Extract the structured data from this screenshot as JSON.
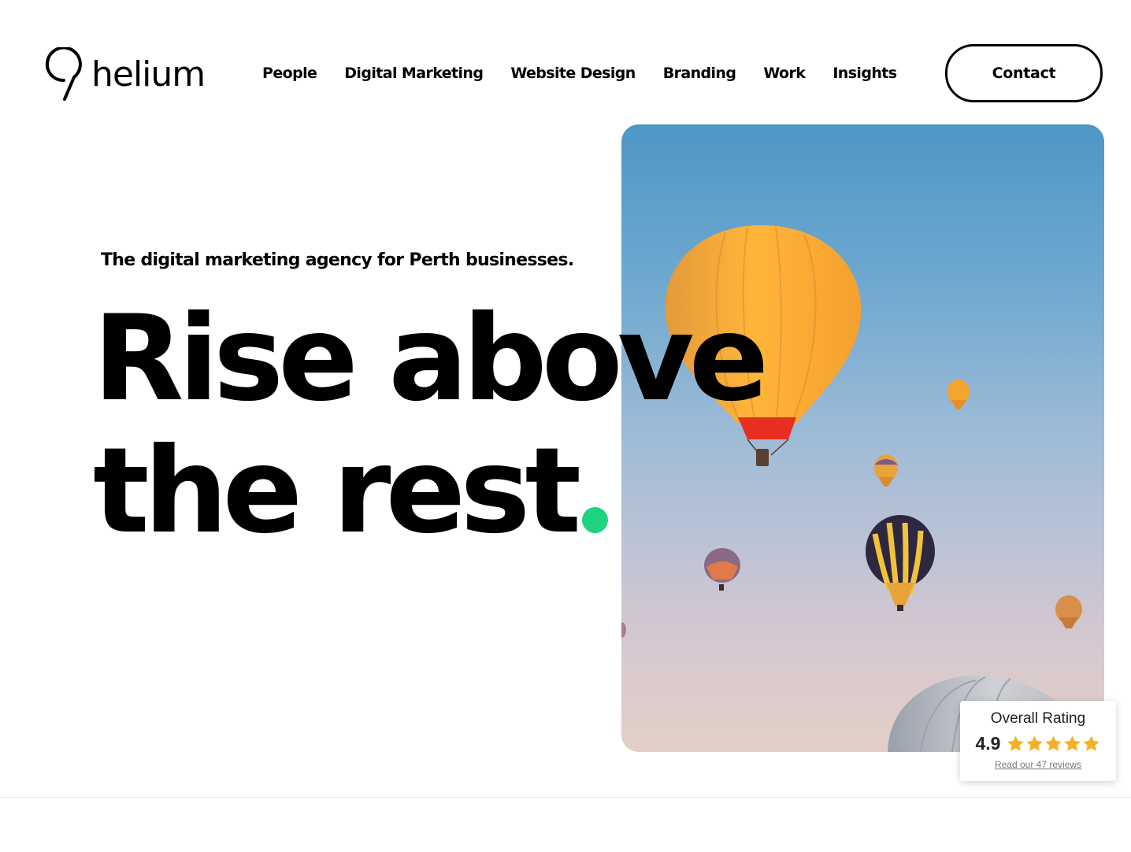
{
  "brand": {
    "logo_text": "helium",
    "logo_icon": "map-pin-icon"
  },
  "nav": {
    "items": [
      {
        "label": "People"
      },
      {
        "label": "Digital Marketing"
      },
      {
        "label": "Website Design"
      },
      {
        "label": "Branding"
      },
      {
        "label": "Work"
      },
      {
        "label": "Insights"
      }
    ],
    "contact_label": "Contact"
  },
  "hero": {
    "tagline": "The digital marketing agency for Perth businesses.",
    "headline_line1": "Rise above",
    "headline_line2": "the rest",
    "accent_color": "#1ed480",
    "image_subject": "hot-air-balloons-image"
  },
  "rating": {
    "title": "Overall Rating",
    "score": "4.9",
    "stars": 5,
    "star_color": "#f6b026",
    "link_text": "Read our 47 reviews"
  }
}
